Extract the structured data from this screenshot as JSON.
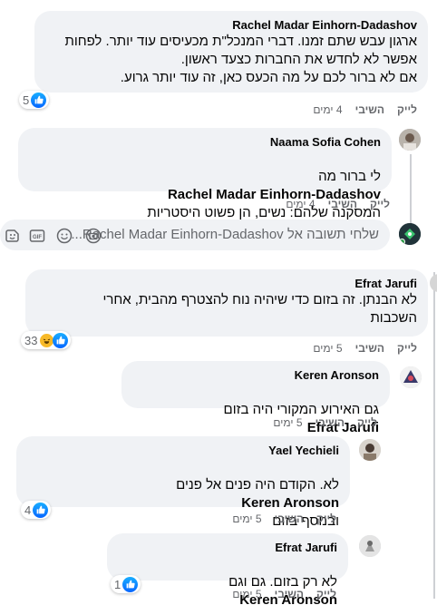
{
  "comments": [
    {
      "author": "Rachel Madar Einhorn-Dadashov",
      "lines": [
        "ארגון עבש שתם זמנו. דברי המנכל\"ת מכעיסים עוד יותר. לפחות",
        "אפשר לא לחדש את החברות כצעד ראשון.",
        "אם לא ברור לכם על מה הכעס כאן, זה עוד יותר גרוע."
      ],
      "like": "לייק",
      "reply": "השיבי",
      "time": "4 ימים",
      "reactions": "5"
    },
    {
      "author": "Naama Sofia Cohen",
      "mention": "Rachel Madar Einhorn-Dadashov",
      "line1_rest": "לי ברור מה",
      "line2": "המסקנה שלהם: נשים, הן פשוט היסטריות",
      "like": "לייק",
      "reply": "השיבי",
      "time": "4 ימים"
    },
    {
      "author": "Efrat Jarufi",
      "lines": [
        "לא הבנתן. זה בזום כדי שיהיה נוח להצטרף מהבית, אחרי",
        "השכבות"
      ],
      "like": "לייק",
      "reply": "השיבי",
      "time": "5 ימים",
      "reactions": "33"
    },
    {
      "author": "Keren Aronson",
      "text_before": "גם האירוע המקורי היה בזום",
      "mention": "Efrat Jarufi",
      "like": "לייק",
      "reply": "השיבי",
      "time": "5 ימים"
    },
    {
      "author": "Yael Yechieli",
      "mention": "Keren Aronson",
      "line1_rest": "לא. הקודם היה פנים אל פנים",
      "line2": "ובנוסף בזום",
      "like": "לייק",
      "reply": "השיבי",
      "time": "5 ימים",
      "reactions": "4"
    },
    {
      "author": "Efrat Jarufi",
      "text_before": "לא רק בזום. גם וגם",
      "mention": "Keren Aronson",
      "like": "לייק",
      "reply": "השיבי",
      "time": "5 ימים",
      "reactions": "1"
    }
  ],
  "reply_box": {
    "placeholder": "שלחי תשובה אל Rachel Madar Einhorn-Dadashov..."
  },
  "colors": {
    "bubble": "#f0f2f5",
    "like_blue": "#0866ff",
    "meta_gray": "#65676b"
  },
  "icons": [
    "like-icon",
    "haha-icon",
    "sticker-icon",
    "gif-icon",
    "emoji-icon",
    "camera-icon",
    "avatar-icon"
  ]
}
